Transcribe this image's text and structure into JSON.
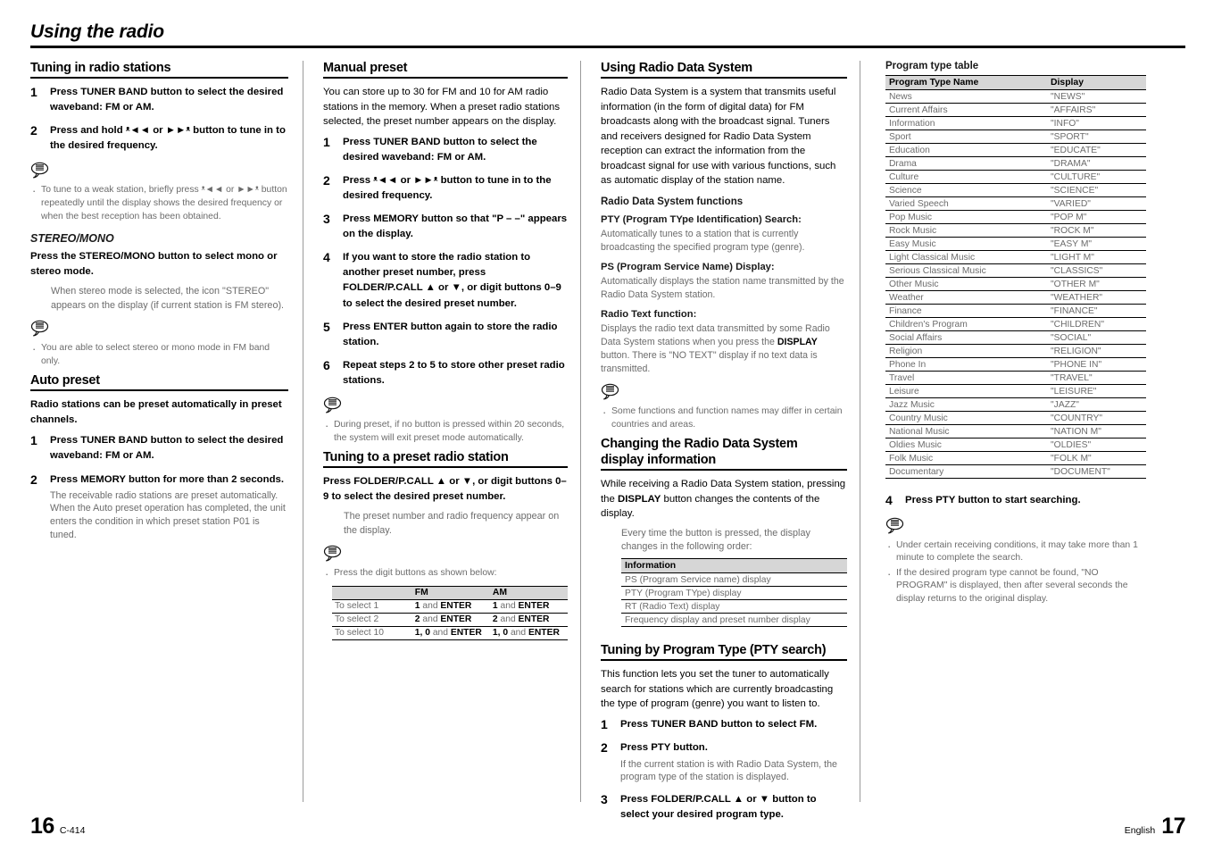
{
  "chapter": {
    "title": "Using the radio"
  },
  "col1": {
    "s1": {
      "heading": "Tuning in radio stations",
      "steps": [
        {
          "num": "1",
          "text": "Press TUNER BAND button to select the desired waveband: FM or AM."
        },
        {
          "num": "2",
          "text": "Press and hold ᵜ◄◄ or ►►ᵜ button to tune in to the desired frequency."
        }
      ],
      "note": "To tune to a weak station, briefly press ᵜ◄◄ or ►►ᵜ button repeatedly until the display shows the desired frequency or when the best reception has been obtained."
    },
    "s2": {
      "heading": "STEREO/MONO",
      "lead": "Press the STEREO/MONO button to select mono or stereo mode.",
      "detail": "When stereo mode is selected, the icon \"STEREO\" appears on the display (if current station is FM stereo).",
      "note": "You are able to select stereo or mono mode in FM band only."
    },
    "s3": {
      "heading": "Auto preset",
      "lead": "Radio stations can be preset automatically in preset channels.",
      "steps": [
        {
          "num": "1",
          "text": "Press TUNER BAND button to select the desired waveband: FM or AM.",
          "note": ""
        },
        {
          "num": "2",
          "text": "Press MEMORY button for more than 2 seconds.",
          "note": "The receivable radio stations are preset automatically.\nWhen the Auto preset operation has completed, the unit enters the condition in which preset station P01 is tuned."
        }
      ]
    }
  },
  "col2": {
    "s1": {
      "heading": "Manual preset",
      "lead": "You can store up to 30 for FM and 10 for AM radio stations in the memory. When a preset radio stations selected, the preset number appears on the display.",
      "steps": [
        {
          "num": "1",
          "text": "Press TUNER BAND button to select the desired waveband: FM or AM."
        },
        {
          "num": "2",
          "text": "Press ᵜ◄◄ or ►►ᵜ button to tune in to the desired frequency."
        },
        {
          "num": "3",
          "text": "Press MEMORY button so that \"P – –\" appears on the display."
        },
        {
          "num": "4",
          "text": "If you want to store the radio station to another preset number, press FOLDER/P.CALL ▲ or ▼, or digit buttons 0–9 to select the desired preset number."
        },
        {
          "num": "5",
          "text": "Press ENTER button again to store the radio station."
        },
        {
          "num": "6",
          "text": "Repeat steps 2 to 5 to store other preset radio stations."
        }
      ],
      "note": "During preset, if no button is pressed within 20 seconds, the system will exit preset mode automatically."
    },
    "s2": {
      "heading": "Tuning to a preset radio station",
      "lead": "Press FOLDER/P.CALL ▲ or ▼, or digit buttons 0–9 to select the desired preset number.",
      "detail": "The preset number and radio frequency appear on the display.",
      "note": "Press the digit buttons as shown below:",
      "table": {
        "headers": [
          "",
          "FM",
          "AM"
        ],
        "rows": [
          {
            "label": "To select 1",
            "fm_key": "1",
            "fm_rest": " and ",
            "fm_enter": "ENTER",
            "am_key": "1",
            "am_rest": " and ",
            "am_enter": "ENTER"
          },
          {
            "label": "To select 2",
            "fm_key": "2",
            "fm_rest": " and ",
            "fm_enter": "ENTER",
            "am_key": "2",
            "am_rest": " and ",
            "am_enter": "ENTER"
          },
          {
            "label": "To select 10",
            "fm_key": "1, 0",
            "fm_rest": " and ",
            "fm_enter": "ENTER",
            "am_key": "1, 0",
            "am_rest": " and ",
            "am_enter": "ENTER"
          }
        ]
      }
    }
  },
  "col3": {
    "s1": {
      "heading": "Using Radio Data System",
      "lead": "Radio Data System is a system that transmits useful information (in the form of digital data) for FM broadcasts along with the broadcast signal. Tuners and receivers designed for Radio Data System reception can extract the information from the broadcast signal for use with various functions, such as automatic display of the station name.",
      "functions_heading": "Radio Data System functions",
      "pty_heading": "PTY (Program TYpe Identification) Search:",
      "pty_body": "Automatically tunes to a station that is currently broadcasting the specified program type (genre).",
      "ps_heading": "PS (Program Service Name) Display:",
      "ps_body": "Automatically displays the station name transmitted by the Radio Data System station.",
      "rt_heading": "Radio Text function:",
      "rt_body_1": "Displays the radio text data transmitted by some Radio Data System stations when you press the ",
      "rt_bold": "DISPLAY",
      "rt_body_2": " button. There is \"NO TEXT\" display if no text data is transmitted.",
      "note": "Some functions and function names may differ in certain countries and areas."
    },
    "s2": {
      "heading_line1": "Changing the Radio Data System",
      "heading_line2": "display information",
      "lead_1": "While receiving a Radio Data System station, pressing the ",
      "lead_bold": "DISPLAY",
      "lead_2": " button changes the contents of the display.",
      "detail": "Every time the button is pressed, the display changes in the following order:",
      "table": {
        "header": "Information",
        "rows": [
          "PS (Program Service name) display",
          "PTY (Program TYpe) display",
          "RT (Radio Text) display",
          "Frequency display and preset number display"
        ]
      }
    },
    "s3": {
      "heading": "Tuning by Program Type (PTY search)",
      "lead": "This function lets you set the tuner to automatically search for stations which are currently broadcasting the type of program (genre) you want to listen to.",
      "steps": [
        {
          "num": "1",
          "text": "Press TUNER BAND button to select FM.",
          "note": ""
        },
        {
          "num": "2",
          "text": "Press PTY button.",
          "note": "If the current station is with Radio Data System, the program type of the station is displayed."
        },
        {
          "num": "3",
          "text": "Press FOLDER/P.CALL ▲ or ▼ button to select your desired program type.",
          "note": ""
        }
      ]
    }
  },
  "col4": {
    "table_title": "Program type table",
    "table": {
      "headers": [
        "Program Type Name",
        "Display"
      ],
      "rows": [
        [
          "News",
          "\"NEWS\""
        ],
        [
          "Current Affairs",
          "\"AFFAIRS\""
        ],
        [
          "Information",
          "\"INFO\""
        ],
        [
          "Sport",
          "\"SPORT\""
        ],
        [
          "Education",
          "\"EDUCATE\""
        ],
        [
          "Drama",
          "\"DRAMA\""
        ],
        [
          "Culture",
          "\"CULTURE\""
        ],
        [
          "Science",
          "\"SCIENCE\""
        ],
        [
          "Varied Speech",
          "\"VARIED\""
        ],
        [
          "Pop Music",
          "\"POP M\""
        ],
        [
          "Rock Music",
          "\"ROCK M\""
        ],
        [
          "Easy Music",
          "\"EASY M\""
        ],
        [
          "Light Classical Music",
          "\"LIGHT M\""
        ],
        [
          "Serious Classical Music",
          "\"CLASSICS\""
        ],
        [
          "Other Music",
          "\"OTHER M\""
        ],
        [
          "Weather",
          "\"WEATHER\""
        ],
        [
          "Finance",
          "\"FINANCE\""
        ],
        [
          "Children's Program",
          "\"CHILDREN\""
        ],
        [
          "Social Affairs",
          "\"SOCIAL\""
        ],
        [
          "Religion",
          "\"RELIGION\""
        ],
        [
          "Phone In",
          "\"PHONE IN\""
        ],
        [
          "Travel",
          "\"TRAVEL\""
        ],
        [
          "Leisure",
          "\"LEISURE\""
        ],
        [
          "Jazz Music",
          "\"JAZZ\""
        ],
        [
          "Country Music",
          "\"COUNTRY\""
        ],
        [
          "National Music",
          "\"NATION M\""
        ],
        [
          "Oldies Music",
          "\"OLDIES\""
        ],
        [
          "Folk Music",
          "\"FOLK M\""
        ],
        [
          "Documentary",
          "\"DOCUMENT\""
        ]
      ]
    },
    "step4": {
      "num": "4",
      "text": "Press PTY button to start searching."
    },
    "notes": [
      "Under certain receiving conditions, it may take more than 1 minute to complete the search.",
      "If the desired program type cannot be found, \"NO PROGRAM\" is displayed, then after several seconds the display returns to the original display."
    ]
  },
  "footer": {
    "left_page": "16",
    "left_model": "C-414",
    "right_lang": "English",
    "right_page": "17"
  }
}
